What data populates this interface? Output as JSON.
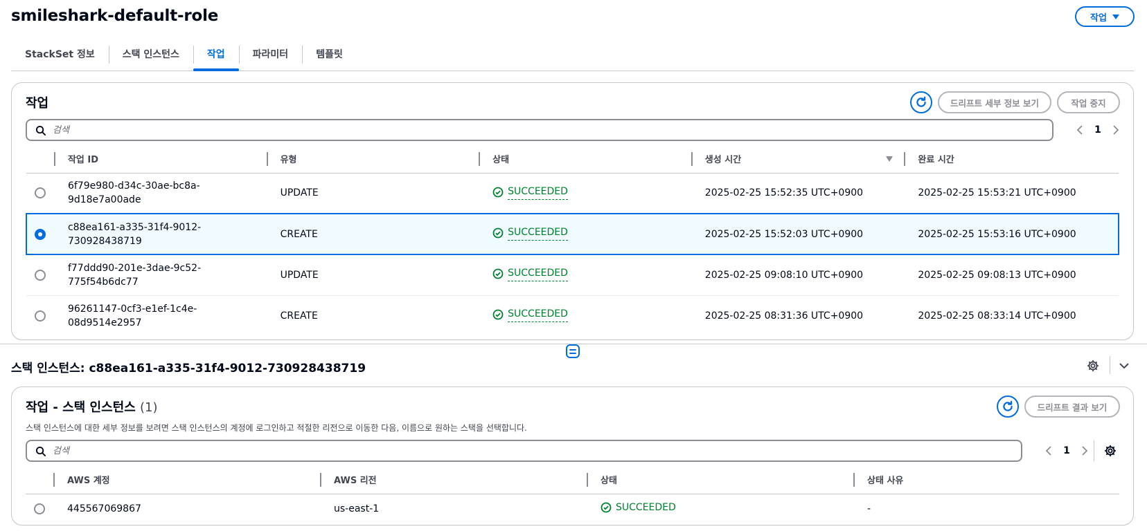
{
  "page": {
    "title": "smileshark-default-role",
    "actions_label": "작업"
  },
  "tabs": [
    {
      "label": "StackSet 정보"
    },
    {
      "label": "스택 인스턴스"
    },
    {
      "label": "작업"
    },
    {
      "label": "파라미터"
    },
    {
      "label": "템플릿"
    }
  ],
  "operations": {
    "title": "작업",
    "drift_details_label": "드리프트 세부 정보 보기",
    "stop_label": "작업 중지",
    "search_placeholder": "검색",
    "page": "1",
    "columns": [
      "작업 ID",
      "유형",
      "상태",
      "생성 시간",
      "완료 시간"
    ],
    "rows": [
      {
        "id_line1": "6f79e980-d34c-30ae-bc8a-",
        "id_line2": "9d18e7a00ade",
        "type": "UPDATE",
        "status": "SUCCEEDED",
        "created": "2025-02-25 15:52:35 UTC+0900",
        "completed": "2025-02-25 15:53:21 UTC+0900"
      },
      {
        "id_line1": "c88ea161-a335-31f4-9012-",
        "id_line2": "730928438719",
        "type": "CREATE",
        "status": "SUCCEEDED",
        "created": "2025-02-25 15:52:03 UTC+0900",
        "completed": "2025-02-25 15:53:16 UTC+0900"
      },
      {
        "id_line1": "f77ddd90-201e-3dae-9c52-",
        "id_line2": "775f54b6dc77",
        "type": "UPDATE",
        "status": "SUCCEEDED",
        "created": "2025-02-25 09:08:10 UTC+0900",
        "completed": "2025-02-25 09:08:13 UTC+0900"
      },
      {
        "id_line1": "96261147-0cf3-e1ef-1c4e-",
        "id_line2": "08d9514e2957",
        "type": "CREATE",
        "status": "SUCCEEDED",
        "created": "2025-02-25 08:31:36 UTC+0900",
        "completed": "2025-02-25 08:33:14 UTC+0900"
      }
    ]
  },
  "split_panel": {
    "title": "스택 인스턴스: c88ea161-a335-31f4-9012-730928438719"
  },
  "instances": {
    "title": "작업 - 스택 인스턴스",
    "count": "(1)",
    "description": "스택 인스턴스에 대한 세부 정보를 보려면 스택 인스턴스의 계정에 로그인하고 적절한 리전으로 이동한 다음, 이름으로 원하는 스택을 선택합니다.",
    "drift_results_label": "드리프트 결과 보기",
    "search_placeholder": "검색",
    "page": "1",
    "columns": [
      "AWS 계정",
      "AWS 리전",
      "상태",
      "상태 사유"
    ],
    "rows": [
      {
        "account": "445567069867",
        "region": "us-east-1",
        "status": "SUCCEEDED",
        "reason": "-"
      }
    ]
  },
  "colors": {
    "accent": "#006ce0",
    "success": "#00802f",
    "selected_row": "#f0fbff",
    "disabled": "#8c8c94"
  }
}
